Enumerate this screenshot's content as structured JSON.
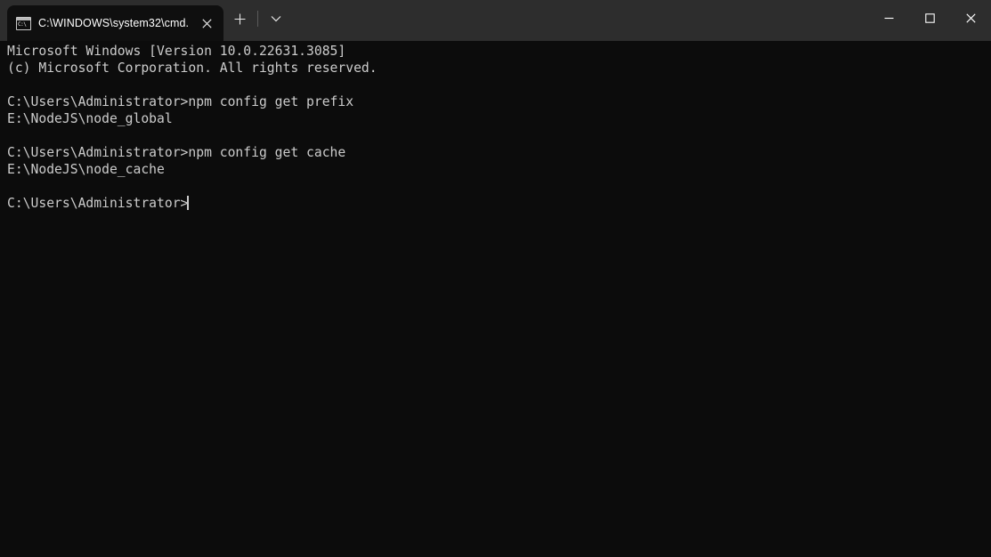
{
  "window": {
    "app_name": "Command Prompt",
    "background_color": "#0c0c0c",
    "titlebar_color": "#2d2d2d",
    "text_color": "#cccccc"
  },
  "titlebar": {
    "tab": {
      "icon_name": "cmd-console-icon",
      "icon_glyph": "C:\\",
      "title": "C:\\WINDOWS\\system32\\cmd.",
      "close_label": "✕"
    },
    "new_tab_label": "+",
    "dropdown_label": "⌄",
    "controls": {
      "minimize_label": "─",
      "maximize_label": "☐",
      "close_label": "✕"
    }
  },
  "terminal": {
    "lines": [
      "Microsoft Windows [Version 10.0.22631.3085]",
      "(c) Microsoft Corporation. All rights reserved.",
      "",
      "C:\\Users\\Administrator>npm config get prefix",
      "E:\\NodeJS\\node_global",
      "",
      "C:\\Users\\Administrator>npm config get cache",
      "E:\\NodeJS\\node_cache",
      ""
    ],
    "prompt": "C:\\Users\\Administrator>",
    "input_value": "",
    "cursor_visible": true
  }
}
